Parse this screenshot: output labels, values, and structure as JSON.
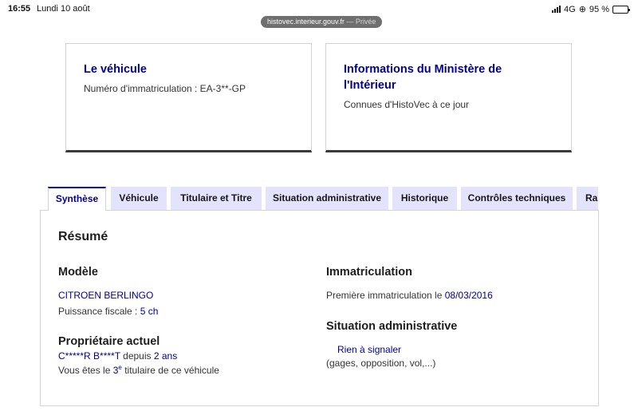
{
  "status_bar": {
    "time": "16:55",
    "date": "Lundi 10 août",
    "network": "4G",
    "battery": "95 %",
    "battery_level": 0.95
  },
  "browser": {
    "url": "histovec.interieur.gouv.fr",
    "private_label": "— Privée"
  },
  "cards": {
    "vehicle": {
      "title": "Le véhicule",
      "text": "Numéro d'immatriculation : EA-3**-GP"
    },
    "ministry": {
      "title_line1": "Informations du Ministère de",
      "title_line2": "l'Intérieur",
      "text": "Connues d'HistoVec à ce jour"
    }
  },
  "tabs": [
    {
      "label": "Synthèse",
      "active": true
    },
    {
      "label": "Véhicule",
      "active": false
    },
    {
      "label": "Titulaire et Titre",
      "active": false
    },
    {
      "label": "Situation administrative",
      "active": false
    },
    {
      "label": "Historique",
      "active": false
    },
    {
      "label": "Contrôles techniques",
      "active": false
    },
    {
      "label": "Rap",
      "active": false
    }
  ],
  "summary": {
    "title": "Résumé",
    "model": {
      "heading": "Modèle",
      "name": "CITROEN BERLINGO",
      "power_label": "Puissance fiscale : ",
      "power_value": "5 ch"
    },
    "owner": {
      "heading": "Propriétaire actuel",
      "name": "C*****R B****T",
      "since_label": " depuis ",
      "since_value": "2 ans",
      "rank_prefix": "Vous êtes le ",
      "rank_number": "3",
      "rank_suffix_sup": "e",
      "rank_suffix": " titulaire de ce véhicule"
    },
    "registration": {
      "heading": "Immatriculation",
      "first_label": "Première immatriculation le ",
      "first_date": "08/03/2016"
    },
    "admin": {
      "heading": "Situation administrative",
      "status": "Rien à signaler",
      "detail": "(gages, opposition, vol,...)"
    }
  }
}
